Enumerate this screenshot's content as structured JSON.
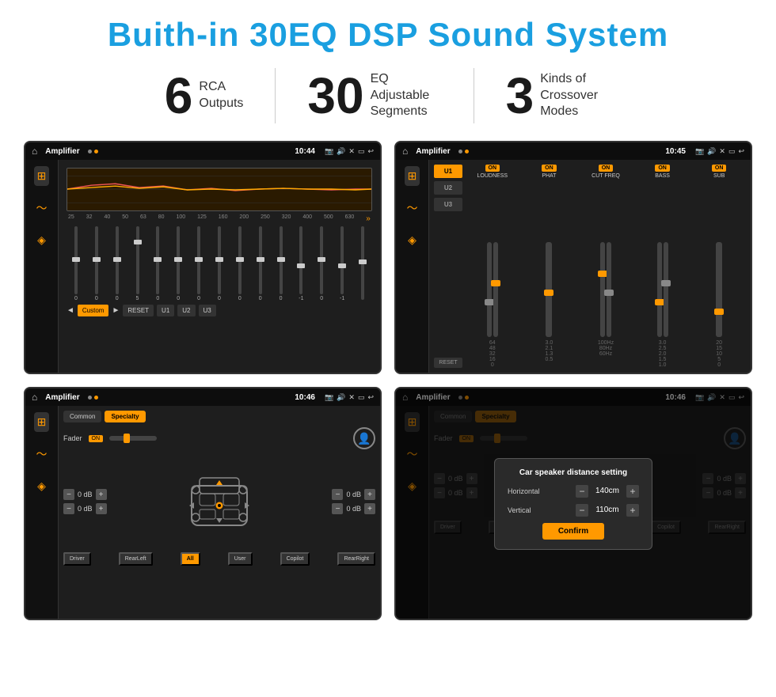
{
  "header": {
    "title": "Buith-in 30EQ DSP Sound System"
  },
  "stats": [
    {
      "number": "6",
      "label_line1": "RCA",
      "label_line2": "Outputs"
    },
    {
      "number": "30",
      "label_line1": "EQ Adjustable",
      "label_line2": "Segments"
    },
    {
      "number": "3",
      "label_line1": "Kinds of",
      "label_line2": "Crossover Modes"
    }
  ],
  "screens": [
    {
      "id": "screen1",
      "time": "10:44",
      "app": "Amplifier",
      "type": "eq",
      "freqs": [
        "25",
        "32",
        "40",
        "50",
        "63",
        "80",
        "100",
        "125",
        "160",
        "200",
        "250",
        "320",
        "400",
        "500",
        "630"
      ],
      "values": [
        "0",
        "0",
        "0",
        "5",
        "0",
        "0",
        "0",
        "0",
        "0",
        "0",
        "0",
        "-1",
        "0",
        "-1",
        ""
      ],
      "preset": "Custom",
      "buttons": [
        "RESET",
        "U1",
        "U2",
        "U3"
      ]
    },
    {
      "id": "screen2",
      "time": "10:45",
      "app": "Amplifier",
      "type": "amp_channels",
      "channels": [
        "U1",
        "U2",
        "U3"
      ],
      "controls": [
        "LOUDNESS",
        "PHAT",
        "CUT FREQ",
        "BASS",
        "SUB"
      ]
    },
    {
      "id": "screen3",
      "time": "10:46",
      "app": "Amplifier",
      "type": "crossover",
      "tabs": [
        "Common",
        "Specialty"
      ],
      "active_tab": "Specialty",
      "fader_label": "Fader",
      "fader_on": "ON",
      "buttons": [
        "Driver",
        "RearLeft",
        "All",
        "User",
        "Copilot",
        "RearRight"
      ],
      "db_values": [
        "0 dB",
        "0 dB",
        "0 dB",
        "0 dB"
      ]
    },
    {
      "id": "screen4",
      "time": "10:46",
      "app": "Amplifier",
      "type": "crossover_dialog",
      "tabs": [
        "Common",
        "Specialty"
      ],
      "dialog": {
        "title": "Car speaker distance setting",
        "horizontal_label": "Horizontal",
        "horizontal_value": "140cm",
        "vertical_label": "Vertical",
        "vertical_value": "110cm",
        "confirm_label": "Confirm"
      },
      "buttons": [
        "Driver",
        "RearLef...",
        "All",
        "User",
        "Copilot",
        "RearRight"
      ],
      "db_values": [
        "0 dB",
        "0 dB"
      ]
    }
  ]
}
